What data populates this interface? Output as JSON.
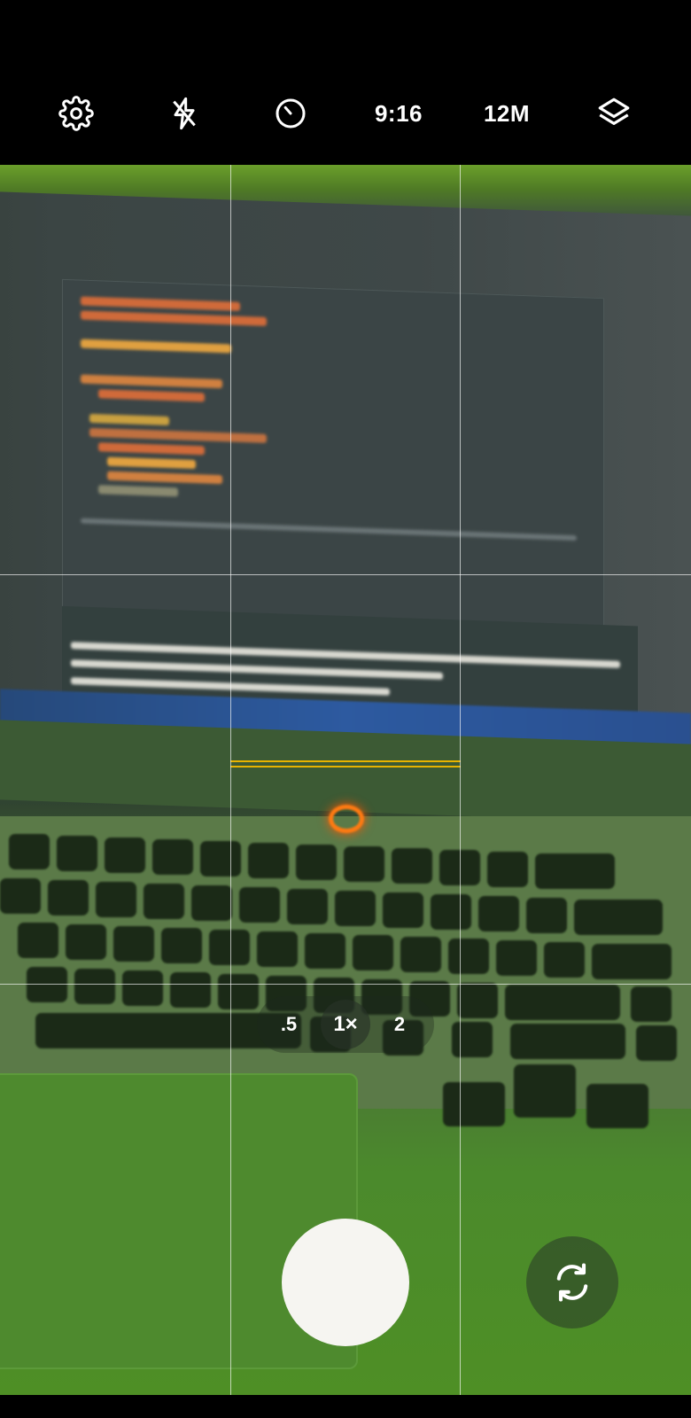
{
  "toolbar": {
    "settings_icon": "gear-icon",
    "flash_icon": "flash-off-icon",
    "timer_icon": "timer-icon",
    "aspect_ratio": "9:16",
    "resolution": "12M",
    "filters_icon": "layers-icon"
  },
  "zoom": {
    "options": [
      ".5",
      "1×",
      "2"
    ],
    "selected": "1×"
  },
  "controls": {
    "shutter_icon": "shutter-button",
    "switch_camera_icon": "switch-camera-icon"
  },
  "colors": {
    "background": "#000000",
    "shutter": "#f6f5f1",
    "focus_indicator": "#e8b300"
  }
}
